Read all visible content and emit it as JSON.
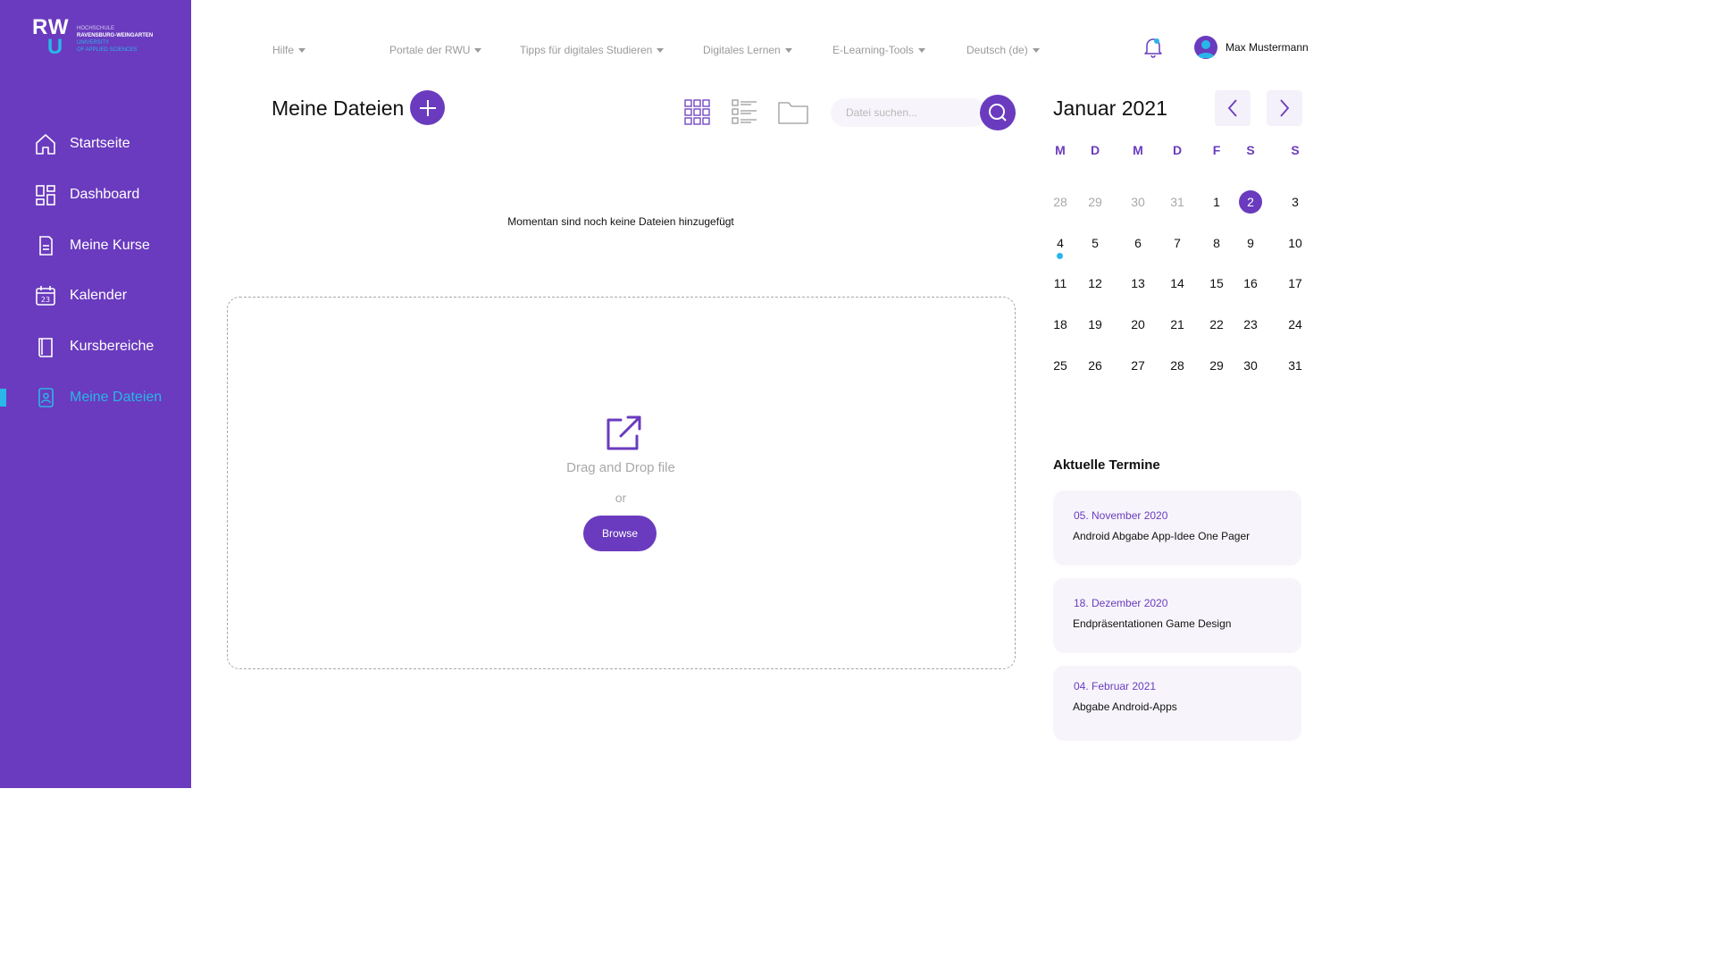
{
  "logo": {
    "mark_top": "RW",
    "mark_bottom": "U",
    "line1": "HOCHSCHULE",
    "line2": "RAVENSBURG-WEINGARTEN",
    "line3": "UNIVERSITY",
    "line4": "OF APPLIED SCIENCES"
  },
  "sidebar": {
    "items": [
      {
        "label": "Startseite",
        "icon": "home-icon"
      },
      {
        "label": "Dashboard",
        "icon": "dashboard-icon"
      },
      {
        "label": "Meine Kurse",
        "icon": "document-icon"
      },
      {
        "label": "Kalender",
        "icon": "calendar-icon"
      },
      {
        "label": "Kursbereiche",
        "icon": "book-icon"
      },
      {
        "label": "Meine Dateien",
        "icon": "user-file-icon",
        "active": true
      }
    ]
  },
  "topnav": {
    "items": [
      "Hilfe",
      "Portale der RWU",
      "Tipps für digitales Studieren",
      "Digitales Lernen",
      "E-Learning-Tools",
      "Deutsch (de)"
    ]
  },
  "user": {
    "name": "Max Mustermann"
  },
  "files": {
    "title": "Meine Dateien",
    "search_placeholder": "Datei suchen...",
    "empty_message": "Momentan sind noch keine Dateien hinzugefügt",
    "dropzone_text": "Drag and Drop file",
    "or_text": "or",
    "browse_label": "Browse"
  },
  "calendar": {
    "title": "Januar 2021",
    "weekdays": [
      "M",
      "D",
      "M",
      "D",
      "F",
      "S",
      "S"
    ],
    "weeks": [
      [
        "28",
        "29",
        "30",
        "31",
        "1",
        "2",
        "3"
      ],
      [
        "4",
        "5",
        "6",
        "7",
        "8",
        "9",
        "10"
      ],
      [
        "11",
        "12",
        "13",
        "14",
        "15",
        "16",
        "17"
      ],
      [
        "18",
        "19",
        "20",
        "21",
        "22",
        "23",
        "24"
      ],
      [
        "25",
        "26",
        "27",
        "28",
        "29",
        "30",
        "31"
      ]
    ],
    "muted_first_row": 4,
    "selected_day": "2",
    "event_day": "4"
  },
  "termine": {
    "title": "Aktuelle Termine",
    "items": [
      {
        "date": "05. November 2020",
        "text": "Android Abgabe App-Idee One Pager"
      },
      {
        "date": "18. Dezember 2020",
        "text": "Endpräsentationen Game Design"
      },
      {
        "date": "04. Februar 2021",
        "text": "Abgabe Android-Apps"
      }
    ]
  },
  "colors": {
    "primary": "#6a3bbe",
    "accent": "#29b6e8",
    "muted": "#a9a9a9"
  }
}
